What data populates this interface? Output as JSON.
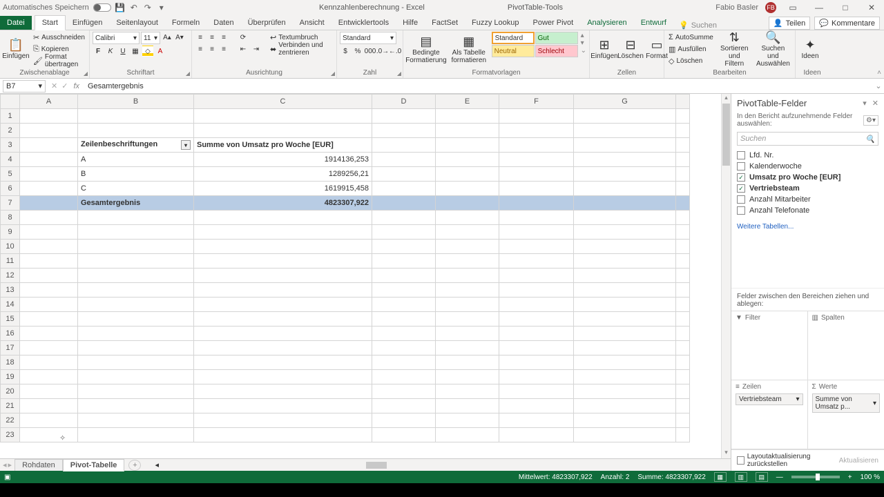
{
  "titlebar": {
    "autosave": "Automatisches Speichern",
    "doc_title": "Kennzahlenberechnung - Excel",
    "tool_context": "PivotTable-Tools",
    "user_name": "Fabio Basler",
    "user_initials": "FB"
  },
  "tabs": {
    "file": "Datei",
    "items": [
      "Start",
      "Einfügen",
      "Seitenlayout",
      "Formeln",
      "Daten",
      "Überprüfen",
      "Ansicht",
      "Entwicklertools",
      "Hilfe",
      "FactSet",
      "Fuzzy Lookup",
      "Power Pivot",
      "Analysieren",
      "Entwurf"
    ],
    "active": "Start",
    "tellme_placeholder": "Suchen",
    "share": "Teilen",
    "comments": "Kommentare"
  },
  "ribbon": {
    "clipboard": {
      "paste": "Einfügen",
      "cut": "Ausschneiden",
      "copy": "Kopieren",
      "format_painter": "Format übertragen",
      "group": "Zwischenablage"
    },
    "font": {
      "name": "Calibri",
      "size": "11",
      "group": "Schriftart"
    },
    "align": {
      "wrap": "Textumbruch",
      "merge": "Verbinden und zentrieren",
      "group": "Ausrichtung"
    },
    "number": {
      "format": "Standard",
      "group": "Zahl"
    },
    "styles": {
      "cond": "Bedingte Formatierung",
      "as_table": "Als Tabelle formatieren",
      "std": "Standard",
      "gut": "Gut",
      "neutral": "Neutral",
      "bad": "Schlecht",
      "group": "Formatvorlagen"
    },
    "cells": {
      "insert": "Einfügen",
      "delete": "Löschen",
      "format": "Format",
      "group": "Zellen"
    },
    "editing": {
      "autosum": "AutoSumme",
      "fill": "Ausfüllen",
      "clear": "Löschen",
      "sort": "Sortieren und Filtern",
      "find": "Suchen und Auswählen",
      "group": "Bearbeiten"
    },
    "ideas": {
      "label": "Ideen",
      "group": "Ideen"
    }
  },
  "formula_bar": {
    "cell_ref": "B7",
    "value": "Gesamtergebnis"
  },
  "grid": {
    "cols": [
      "A",
      "B",
      "C",
      "D",
      "E",
      "F",
      "G"
    ],
    "header_row_labels": "Zeilenbeschriftungen",
    "header_value": "Summe von Umsatz pro Woche [EUR]",
    "rows": [
      {
        "label": "A",
        "value": "1914136,253"
      },
      {
        "label": "B",
        "value": "1289256,21"
      },
      {
        "label": "C",
        "value": "1619915,458"
      }
    ],
    "total_label": "Gesamtergebnis",
    "total_value": "4823307,922"
  },
  "sheets": {
    "tabs": [
      "Rohdaten",
      "Pivot-Tabelle"
    ],
    "active": "Pivot-Tabelle"
  },
  "fieldlist": {
    "title": "PivotTable-Felder",
    "subtitle": "In den Bericht aufzunehmende Felder auswählen:",
    "search_placeholder": "Suchen",
    "fields": [
      {
        "name": "Lfd. Nr.",
        "checked": false
      },
      {
        "name": "Kalenderwoche",
        "checked": false
      },
      {
        "name": "Umsatz pro Woche [EUR]",
        "checked": true
      },
      {
        "name": "Vertriebsteam",
        "checked": true
      },
      {
        "name": "Anzahl Mitarbeiter",
        "checked": false
      },
      {
        "name": "Anzahl Telefonate",
        "checked": false
      }
    ],
    "more_tables": "Weitere Tabellen...",
    "drag_label": "Felder zwischen den Bereichen ziehen und ablegen:",
    "quads": {
      "filter": "Filter",
      "cols": "Spalten",
      "rows": "Zeilen",
      "values": "Werte"
    },
    "row_item": "Vertriebsteam",
    "value_item": "Summe von Umsatz p...",
    "defer": "Layoutaktualisierung zurückstellen",
    "update": "Aktualisieren"
  },
  "statusbar": {
    "avg_label": "Mittelwert:",
    "avg": "4823307,922",
    "count_label": "Anzahl:",
    "count": "2",
    "sum_label": "Summe:",
    "sum": "4823307,922",
    "zoom": "100 %"
  }
}
